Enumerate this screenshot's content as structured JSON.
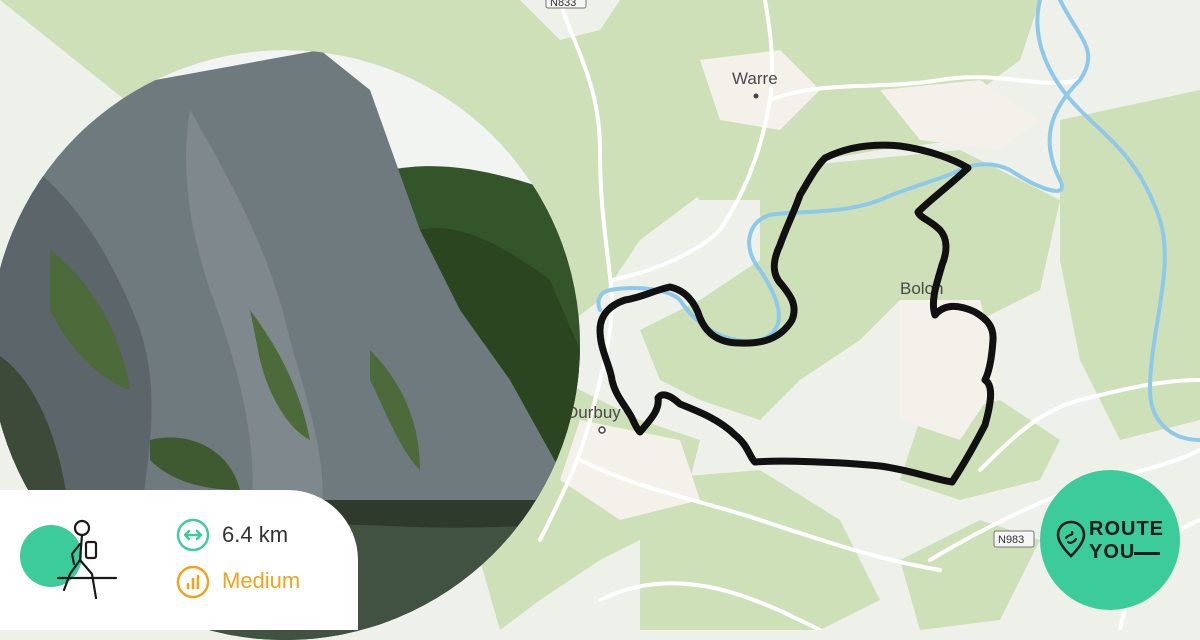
{
  "map": {
    "places": {
      "warre": "Warre",
      "durbuy": "Durbuy",
      "bomal": "Bolon"
    },
    "roads": {
      "n833": "N833",
      "n983": "N983"
    },
    "colors": {
      "route": "#111111",
      "river": "#8ec9ea",
      "forest": "#c9dcb4",
      "field": "#eef0ea",
      "road": "#ffffff"
    }
  },
  "route": {
    "activity_icon": "hiking-person-icon",
    "distance": "6.4 km",
    "distance_icon": "horizontal-arrows-icon",
    "difficulty": "Medium",
    "difficulty_icon": "signal-bars-icon",
    "colors": {
      "accent": "#3ccb9a",
      "difficulty": "#f2a31a"
    }
  },
  "brand": {
    "line1": "ROUTE",
    "line2": "YOU",
    "icon": "route-pin-icon"
  }
}
